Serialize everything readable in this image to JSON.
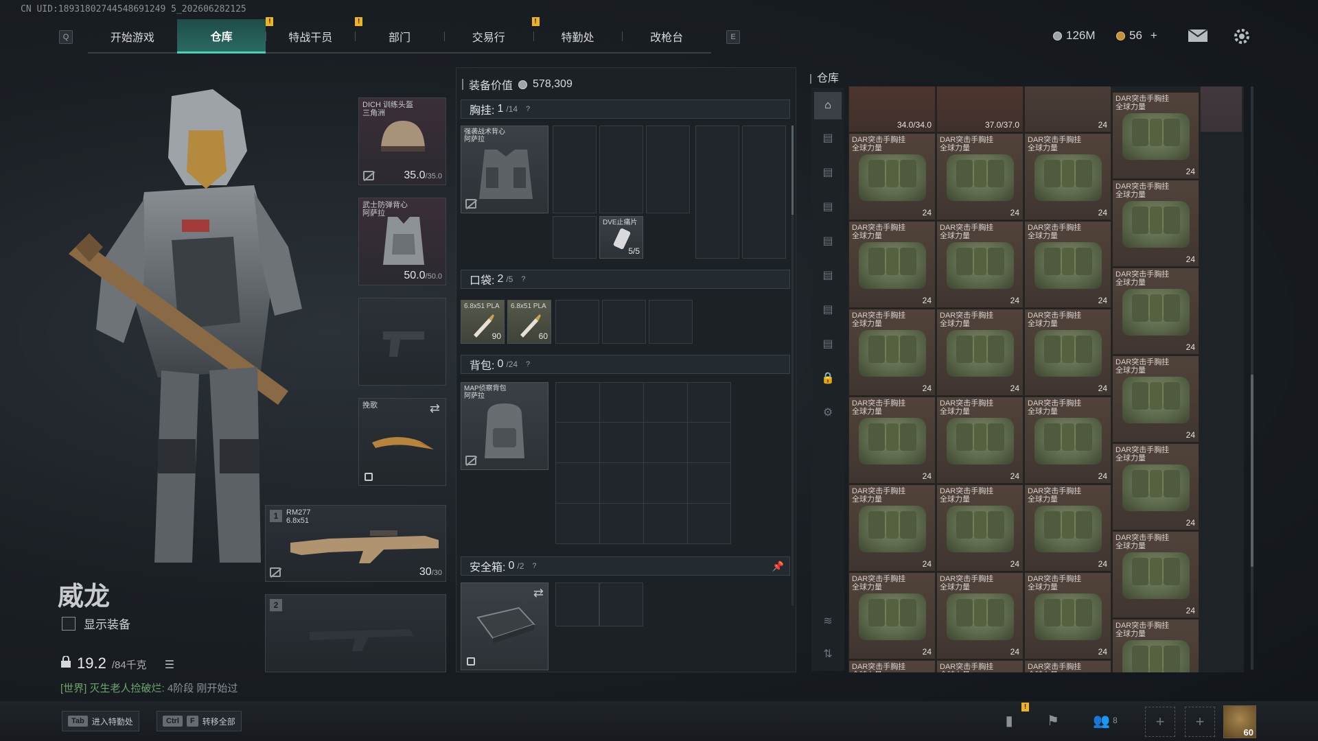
{
  "uid": "CN UID:18931802744548691249 5_202606282125",
  "topnav": {
    "left_key": "Q",
    "right_key": "E",
    "tabs": [
      {
        "label": "开始游戏",
        "active": false,
        "alert": false
      },
      {
        "label": "仓库",
        "active": true,
        "alert": false
      },
      {
        "label": "特战干员",
        "active": false,
        "alert": true
      },
      {
        "label": "部门",
        "active": false,
        "alert": true
      },
      {
        "label": "交易行",
        "active": false,
        "alert": false
      },
      {
        "label": "特勤处",
        "active": false,
        "alert": true
      },
      {
        "label": "改枪台",
        "active": false,
        "alert": false
      }
    ],
    "alert_mark": "!"
  },
  "currency": {
    "silver": "126M",
    "gold": "56",
    "gold_add": "+"
  },
  "operator": {
    "name": "威龙",
    "show_equip_label": "显示装备",
    "weight_current": "19.2",
    "weight_max": "/84千克"
  },
  "chat": {
    "channel": "[世界]",
    "sender": "灭生老人捡破烂:",
    "message": "4阶段 刚开始过"
  },
  "equip_slots": {
    "helmet": {
      "label": "DICH 训练头盔",
      "sub": "三角洲",
      "dur": "35.0",
      "dur_max": "/35.0"
    },
    "armor": {
      "label": "武士防弹背心",
      "sub": "阿萨拉",
      "dur": "50.0",
      "dur_max": "/50.0"
    },
    "melee": {
      "label": "挽歌"
    },
    "primary": {
      "slot": "1",
      "name": "RM277",
      "caliber": "6.8x51",
      "ammo": "30",
      "ammo_max": "/30"
    },
    "secondary": {
      "slot": "2"
    }
  },
  "inventory": {
    "equip_value_label": "装备价值",
    "equip_value": "578,309",
    "chest": {
      "label": "胸挂:",
      "count": "1",
      "max": "/14",
      "help": "?",
      "item": "强袭战术背心",
      "item_sub": "阿萨拉",
      "dve_item": "DVE止痛片",
      "dve_qty": "5/5"
    },
    "pocket": {
      "label": "口袋:",
      "count": "2",
      "max": "/5",
      "help": "?",
      "ammo1": "6.8x51 PLA",
      "ammo1_qty": "90",
      "ammo2": "6.8x51 PLA",
      "ammo2_qty": "60"
    },
    "backpack": {
      "label": "背包:",
      "count": "0",
      "max": "/24",
      "help": "?",
      "item": "MAP侦察背包",
      "item_sub": "阿萨拉"
    },
    "safebox": {
      "label": "安全箱:",
      "count": "0",
      "max": "/2",
      "help": "?"
    }
  },
  "warehouse": {
    "title": "仓库",
    "top_row": [
      {
        "qty": "34.0/34.0"
      },
      {
        "qty": "37.0/37.0"
      },
      {
        "qty": "24"
      }
    ],
    "item_name_line1": "DAR突击手胸挂",
    "item_name_line2": "全球力量",
    "item_qty": "24",
    "sidebar_icons": [
      "home-icon",
      "tab-1-icon",
      "tab-2-icon",
      "tab-3-icon",
      "tab-4-icon",
      "tab-5-icon",
      "tab-6-icon",
      "tab-7-icon",
      "lock-icon",
      "gear-icon",
      "layers-icon",
      "sort-icon"
    ]
  },
  "bottom": {
    "tab_key": "Tab",
    "tab_label": "进入特勤处",
    "ctrl_key": "Ctrl",
    "f_key": "F",
    "ctrl_label": "转移全部",
    "friends_count": "8",
    "level": "60"
  }
}
